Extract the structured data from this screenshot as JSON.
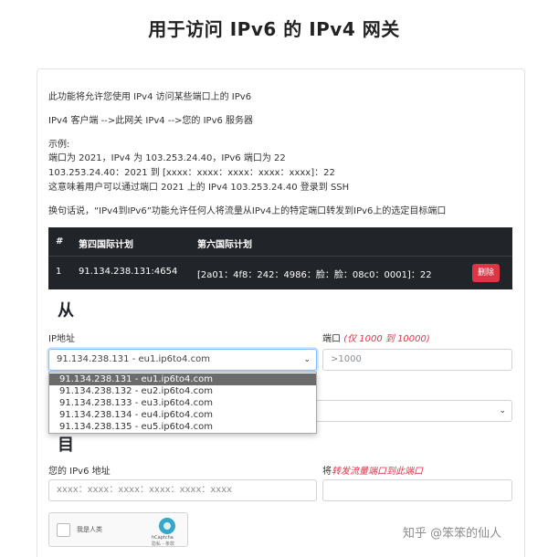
{
  "page": {
    "title": "用于访问 IPv6 的 IPv4 网关"
  },
  "intro": {
    "line1": "此功能将允许您使用 IPv4 访问某些端口上的 IPv6",
    "line2": "IPv4 客户端 -->此网关 IPv4 -->您的 IPv6 服务器",
    "example_title": "示例:",
    "example_1": "端口为 2021，IPv4 为 103.253.24.40，IPv6 端口为 22",
    "example_2": "103.253.24.40：2021 到 [xxxx：xxxx：xxxx：xxxx：xxxx]：22",
    "example_3": "这意味着用户可以通过端口 2021 上的 IPv4 103.253.24.40 登录到 SSH",
    "summary": "换句话说，“IPv4到IPv6”功能允许任何人将流量从IPv4上的特定端口转发到IPv6上的选定目标端口"
  },
  "table": {
    "headers": {
      "num": "#",
      "ipv4": "第四国际计划",
      "ipv6": "第六国际计划"
    },
    "rows": [
      {
        "num": "1",
        "ipv4": "91.134.238.131:4654",
        "ipv6": "[2a01：4f8：242：4986：脸：脸：08c0：0001]：22",
        "action": "删除"
      }
    ]
  },
  "from_section": {
    "heading": "从",
    "ip_label": "IP地址",
    "port_label": "端口",
    "port_hint": "(仅 1000 到 10000)",
    "ip_selected": "91.134.238.131 - eu1.ip6to4.com",
    "port_placeholder": ">1000"
  },
  "dropdown_options": [
    "91.134.238.131 - eu1.ip6to4.com",
    "91.134.238.132 - eu2.ip6to4.com",
    "91.134.238.133 - eu3.ip6to4.com",
    "91.134.238.134 - eu4.ip6to4.com",
    "91.134.238.135 - eu5.ip6to4.com"
  ],
  "to_section": {
    "heading": "目",
    "ipv6_label": "您的 IPv6 地址",
    "port_label_prefix": "将",
    "port_label_hint": "转发流量端口到此端口",
    "ipv6_placeholder": "xxxx：xxxx：xxxx：xxxx：xxxx：xxxx"
  },
  "captcha": {
    "label": "我是人类",
    "brand": "hCaptcha",
    "links": "隐私 - 条款"
  },
  "watermark": "知乎 @笨笨的仙人"
}
